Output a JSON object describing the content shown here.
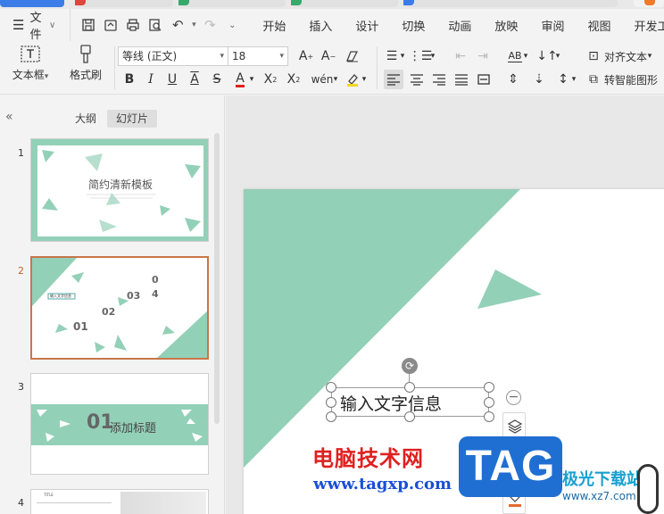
{
  "menu": {
    "file_label": "文件",
    "tabs": [
      "开始",
      "插入",
      "设计",
      "切换",
      "动画",
      "放映",
      "审阅",
      "视图",
      "开发工具"
    ]
  },
  "ribbon": {
    "textbox_label": "文本框",
    "format_painter_label": "格式刷",
    "font_name": "等线 (正文)",
    "font_size": "18",
    "align_text_label": "对齐文本",
    "smartart_label": "转智能图形"
  },
  "panel": {
    "tab_outline": "大纲",
    "tab_slides": "幻灯片",
    "slides": [
      {
        "num": "1",
        "title": "简约清新模板"
      },
      {
        "num": "2",
        "label_box": "输入文字信息",
        "items": [
          "01",
          "02",
          "03",
          "0",
          "4"
        ]
      },
      {
        "num": "3",
        "big_num": "01",
        "title": "添加标题"
      },
      {
        "num": "4",
        "title": "TITLE"
      }
    ]
  },
  "slide": {
    "textbox_text": "输入文字信息",
    "accent_color": "#93d0b8"
  },
  "watermark": {
    "cn_text": "电脑技术网",
    "url": "www.tagxp.com",
    "tag": "TAG",
    "site_name": "极光下载站",
    "site_url": "www.xz7.com"
  }
}
